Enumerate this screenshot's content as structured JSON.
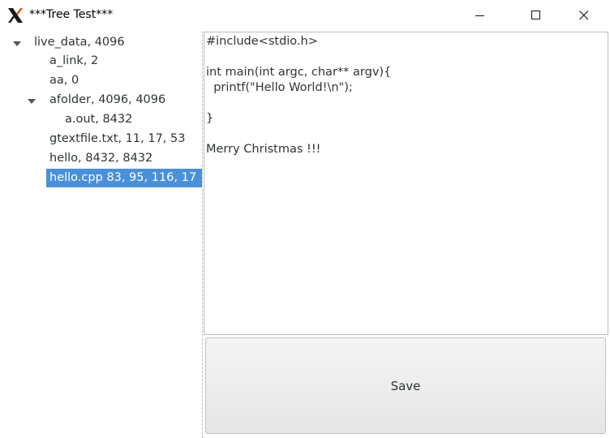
{
  "window": {
    "title": "***Tree Test***",
    "app_icon": "x-logo-icon",
    "controls": [
      "minimize-icon",
      "maximize-icon",
      "close-icon"
    ]
  },
  "tree": {
    "rows": [
      {
        "label": "live_data, 4096",
        "depth": 0,
        "expanded": true
      },
      {
        "label": "a_link, 2",
        "depth": 1
      },
      {
        "label": "aa, 0",
        "depth": 1
      },
      {
        "label": "afolder, 4096, 4096",
        "depth": 1,
        "expanded": true
      },
      {
        "label": "a.out, 8432",
        "depth": 2
      },
      {
        "label": "gtextfile.txt, 11, 17, 53",
        "depth": 1
      },
      {
        "label": "hello, 8432, 8432",
        "depth": 1
      },
      {
        "label": "hello.cpp 83, 95, 116, 17",
        "depth": 1,
        "selected": true
      }
    ]
  },
  "editor": {
    "content": "#include<stdio.h>\n\nint main(int argc, char** argv){\n  printf(\"Hello World!\\n\");\n\n}\n\nMerry Christmas !!!"
  },
  "save_button": {
    "label": "Save"
  },
  "colors": {
    "selection": "#4a90d9",
    "text": "#2e3436"
  }
}
